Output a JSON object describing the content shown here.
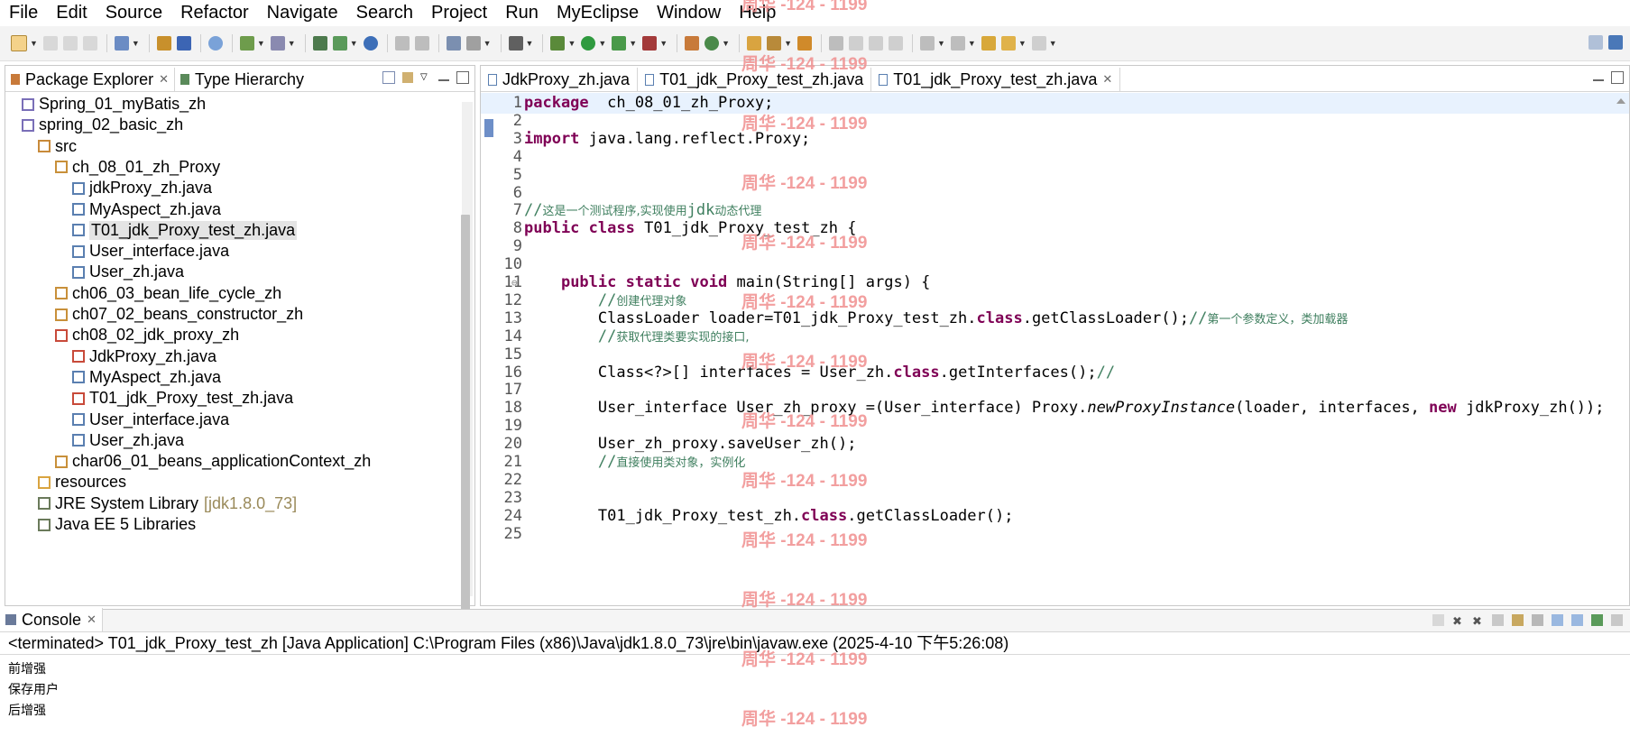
{
  "menu": [
    "File",
    "Edit",
    "Source",
    "Refactor",
    "Navigate",
    "Search",
    "Project",
    "Run",
    "MyEclipse",
    "Window",
    "Help"
  ],
  "colors": {
    "keyword": "#7f0055",
    "comment": "#3f7f5f",
    "watermark": "#f08f8f",
    "selection": "#e4e4e4",
    "current_line": "#e8f2fe"
  },
  "left_view": {
    "tabs": [
      {
        "label": "Package Explorer",
        "icon": "package-explorer-icon"
      },
      {
        "label": "Type Hierarchy",
        "icon": "type-hierarchy-icon"
      }
    ],
    "tree": [
      {
        "label": "Spring_01_myBatis_zh",
        "icon": "project-icon"
      },
      {
        "label": "spring_02_basic_zh",
        "icon": "project-icon"
      },
      {
        "label": "src",
        "icon": "source-folder-icon"
      },
      {
        "label": "ch_08_01_zh_Proxy",
        "icon": "package-icon"
      },
      {
        "label": "jdkProxy_zh.java",
        "icon": "java-file-icon"
      },
      {
        "label": "MyAspect_zh.java",
        "icon": "java-file-icon"
      },
      {
        "label": "T01_jdk_Proxy_test_zh.java",
        "icon": "java-file-icon",
        "selected": true
      },
      {
        "label": "User_interface.java",
        "icon": "java-file-icon"
      },
      {
        "label": "User_zh.java",
        "icon": "java-file-icon"
      },
      {
        "label": "ch06_03_bean_life_cycle_zh",
        "icon": "package-icon"
      },
      {
        "label": "ch07_02_beans_constructor_zh",
        "icon": "package-icon"
      },
      {
        "label": "ch08_02_jdk_proxy_zh",
        "icon": "package-error-icon"
      },
      {
        "label": "JdkProxy_zh.java",
        "icon": "java-file-error-icon"
      },
      {
        "label": "MyAspect_zh.java",
        "icon": "java-file-icon"
      },
      {
        "label": "T01_jdk_Proxy_test_zh.java",
        "icon": "java-file-error-icon"
      },
      {
        "label": "User_interface.java",
        "icon": "java-file-icon"
      },
      {
        "label": "User_zh.java",
        "icon": "java-file-icon"
      },
      {
        "label": "char06_01_beans_applicationContext_zh",
        "icon": "package-icon"
      },
      {
        "label": "resources",
        "icon": "folder-icon"
      },
      {
        "label": "JRE System Library",
        "icon": "library-icon",
        "extra": "[jdk1.8.0_73]"
      },
      {
        "label": "Java EE 5 Libraries",
        "icon": "library-icon"
      }
    ]
  },
  "editor": {
    "tabs": [
      {
        "label": "JdkProxy_zh.java"
      },
      {
        "label": "T01_jdk_Proxy_test_zh.java"
      },
      {
        "label": "T01_jdk_Proxy_test_zh.java",
        "active": true
      }
    ],
    "lines": [
      {
        "n": "1",
        "parts": [
          [
            "kw",
            "package"
          ],
          [
            "",
            "  ch_08_01_zh_Proxy;"
          ]
        ]
      },
      {
        "n": "2",
        "parts": []
      },
      {
        "n": "3",
        "parts": [
          [
            "kw",
            "import"
          ],
          [
            "",
            " java.lang.reflect.Proxy;"
          ]
        ]
      },
      {
        "n": "4",
        "parts": []
      },
      {
        "n": "5",
        "parts": []
      },
      {
        "n": "6",
        "parts": []
      },
      {
        "n": "7",
        "parts": [
          [
            "cm",
            "//"
          ],
          [
            "cmz",
            "这是一个测试程序,实现使用"
          ],
          [
            "cm",
            "jdk"
          ],
          [
            "cmz",
            "动态代理"
          ]
        ]
      },
      {
        "n": "8",
        "parts": [
          [
            "kw",
            "public"
          ],
          [
            "",
            " "
          ],
          [
            "kw",
            "class"
          ],
          [
            "",
            " T01_jdk_Proxy_test_zh {"
          ]
        ]
      },
      {
        "n": "9",
        "parts": []
      },
      {
        "n": "10",
        "parts": []
      },
      {
        "n": "11",
        "fold": true,
        "parts": [
          [
            "",
            "    "
          ],
          [
            "kw",
            "public"
          ],
          [
            "",
            " "
          ],
          [
            "kw",
            "static"
          ],
          [
            "",
            " "
          ],
          [
            "kw",
            "void"
          ],
          [
            "",
            " main(String[] args) {"
          ]
        ]
      },
      {
        "n": "12",
        "parts": [
          [
            "",
            "        "
          ],
          [
            "cm",
            "//"
          ],
          [
            "cmz",
            "创建代理对象"
          ]
        ]
      },
      {
        "n": "13",
        "parts": [
          [
            "",
            "        ClassLoader loader=T01_jdk_Proxy_test_zh."
          ],
          [
            "kw",
            "class"
          ],
          [
            "",
            ".getClassLoader();"
          ],
          [
            "cm",
            "//"
          ],
          [
            "cmz",
            "第一个参数定义，类加载器"
          ]
        ]
      },
      {
        "n": "14",
        "parts": [
          [
            "",
            "        "
          ],
          [
            "cm",
            "//"
          ],
          [
            "cmz",
            "获取代理类要实现的接口,"
          ]
        ]
      },
      {
        "n": "15",
        "parts": []
      },
      {
        "n": "16",
        "parts": [
          [
            "",
            "        Class<?>[] interfaces = User_zh."
          ],
          [
            "kw",
            "class"
          ],
          [
            "",
            ".getInterfaces();"
          ],
          [
            "cm",
            "//"
          ]
        ]
      },
      {
        "n": "17",
        "parts": []
      },
      {
        "n": "18",
        "parts": [
          [
            "",
            "        User_interface User_zh_proxy =(User_interface) Proxy."
          ],
          [
            "it",
            "newProxyInstance"
          ],
          [
            "",
            "(loader, interfaces, "
          ],
          [
            "kw",
            "new"
          ],
          [
            "",
            " jdkProxy_zh());"
          ]
        ]
      },
      {
        "n": "19",
        "parts": []
      },
      {
        "n": "20",
        "parts": [
          [
            "",
            "        User_zh_proxy.saveUser_zh();"
          ]
        ]
      },
      {
        "n": "21",
        "parts": [
          [
            "",
            "        "
          ],
          [
            "cm",
            "//"
          ],
          [
            "cmz",
            "直接使用类对象，实例化"
          ]
        ]
      },
      {
        "n": "22",
        "parts": []
      },
      {
        "n": "23",
        "parts": []
      },
      {
        "n": "24",
        "parts": [
          [
            "",
            "        T01_jdk_Proxy_test_zh."
          ],
          [
            "kw",
            "class"
          ],
          [
            "",
            ".getClassLoader();"
          ]
        ]
      },
      {
        "n": "25",
        "parts": []
      }
    ]
  },
  "console": {
    "tab_label": "Console",
    "header": "<terminated> T01_jdk_Proxy_test_zh [Java Application] C:\\Program Files (x86)\\Java\\jdk1.8.0_73\\jre\\bin\\javaw.exe (2025-4-10 下午5:26:08)",
    "output": [
      "前增强",
      "保存用户",
      "后增强"
    ]
  },
  "watermark": "周华 -124 - 1199"
}
